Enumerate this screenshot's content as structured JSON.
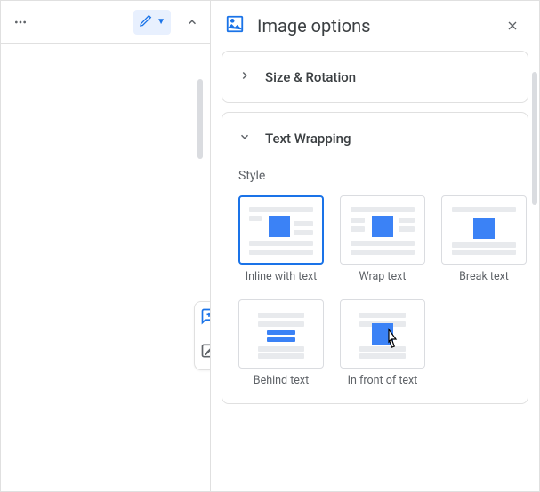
{
  "panel": {
    "title": "Image options",
    "sections": {
      "size": {
        "label": "Size & Rotation"
      },
      "wrap": {
        "label": "Text Wrapping",
        "style_label": "Style",
        "options": {
          "inline": "Inline with text",
          "wrap": "Wrap text",
          "break": "Break text",
          "behind": "Behind text",
          "front": "In front of text"
        }
      }
    }
  }
}
